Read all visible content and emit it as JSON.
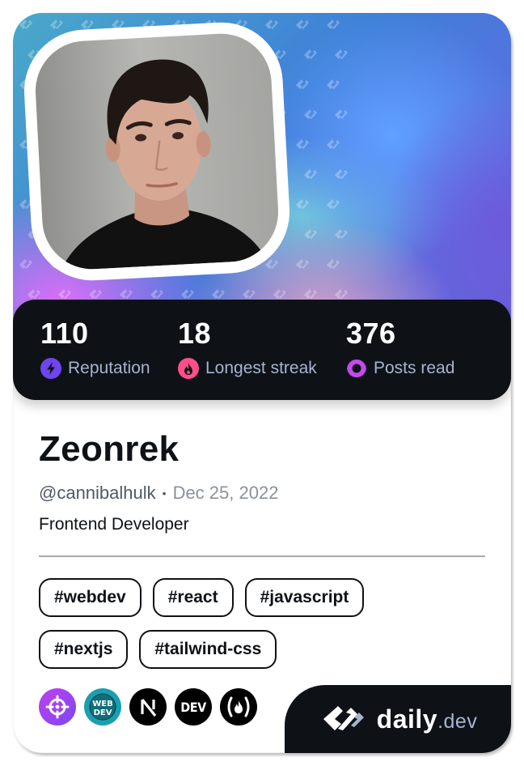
{
  "profile": {
    "display_name": "Zeonrek",
    "handle": "@cannibalhulk",
    "separator": "•",
    "joined_date": "Dec 25, 2022",
    "bio": "Frontend Developer"
  },
  "stats": [
    {
      "value": "110",
      "label": "Reputation",
      "icon": "lightning-icon",
      "color": "#6f45f0"
    },
    {
      "value": "18",
      "label": "Longest streak",
      "icon": "flame-icon",
      "color": "#ff4f8b"
    },
    {
      "value": "376",
      "label": "Posts read",
      "icon": "ring-icon",
      "color": "#c549ef"
    }
  ],
  "tags": [
    "#webdev",
    "#react",
    "#javascript",
    "#nextjs",
    "#tailwind-css"
  ],
  "sources": [
    {
      "name": "crosshair-source-icon",
      "bg": "#a93df0"
    },
    {
      "name": "webdev-source-icon",
      "text1": "WEB",
      "text2": "DEV",
      "bg": "#1a9fae"
    },
    {
      "name": "nextjs-source-icon",
      "text": "N",
      "bg": "#000000"
    },
    {
      "name": "dev-to-source-icon",
      "text": "DEV",
      "bg": "#000000"
    },
    {
      "name": "freecodecamp-source-icon",
      "text": "(🔥)",
      "bg": "#000000"
    }
  ],
  "brand": {
    "name": "daily",
    "suffix": ".dev"
  },
  "colors": {
    "dark": "#0e1217",
    "label": "#a8b3cf",
    "reputation": "#6f45f0",
    "streak": "#ff4f8b",
    "posts": "#c549ef"
  }
}
